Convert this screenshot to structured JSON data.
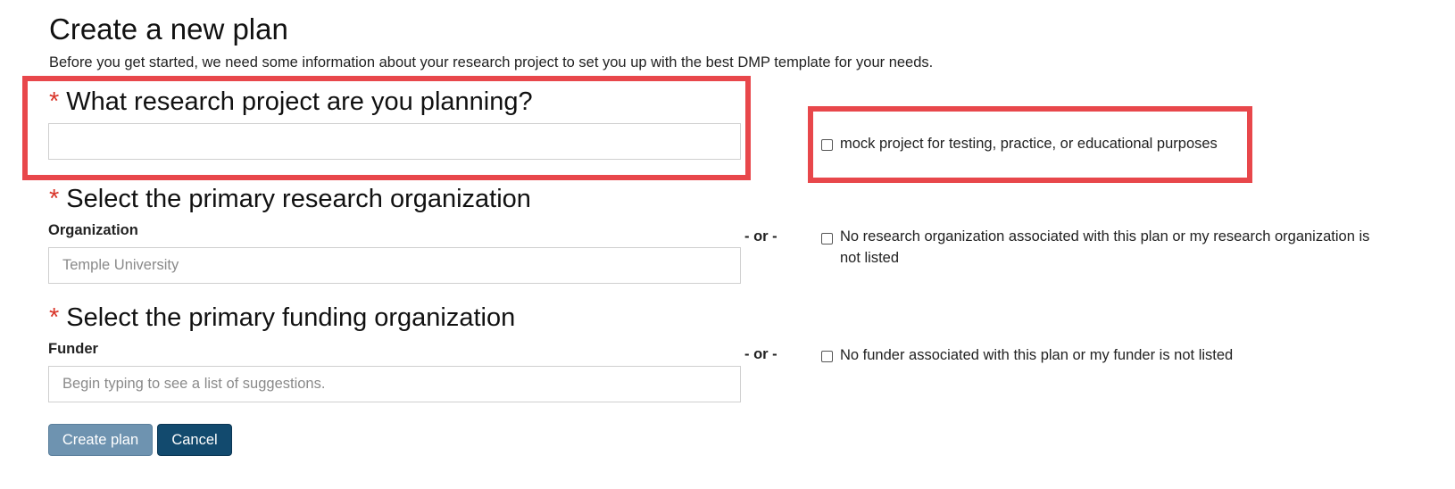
{
  "page": {
    "title": "Create a new plan",
    "intro": "Before you get started, we need some information about your research project to set you up with the best DMP template for your needs."
  },
  "required_marker": "*",
  "project": {
    "question": "What research project are you planning?",
    "input_value": "",
    "input_placeholder": "",
    "mock_checkbox_checked": false,
    "mock_checkbox_label": "mock project for testing, practice, or educational purposes"
  },
  "organization": {
    "question": "Select the primary research organization",
    "label": "Organization",
    "input_value": "",
    "input_placeholder": "Temple University",
    "or_text": "- or -",
    "none_checkbox_checked": false,
    "none_checkbox_label": "No research organization associated with this plan or my research organization is not listed"
  },
  "funder": {
    "question": "Select the primary funding organization",
    "label": "Funder",
    "input_value": "",
    "input_placeholder": "Begin typing to see a list of suggestions.",
    "or_text": "- or -",
    "none_checkbox_checked": false,
    "none_checkbox_label": "No funder associated with this plan or my funder is not listed"
  },
  "actions": {
    "create_label": "Create plan",
    "cancel_label": "Cancel"
  },
  "colors": {
    "required_marker": "#d9362a",
    "highlight_border": "#e8474b",
    "create_button_bg": "#6e93b0",
    "cancel_button_bg": "#124a6e"
  },
  "icons": {
    "highlight": "red-annotation-rectangle",
    "checkbox": "checkbox-unchecked-icon"
  }
}
